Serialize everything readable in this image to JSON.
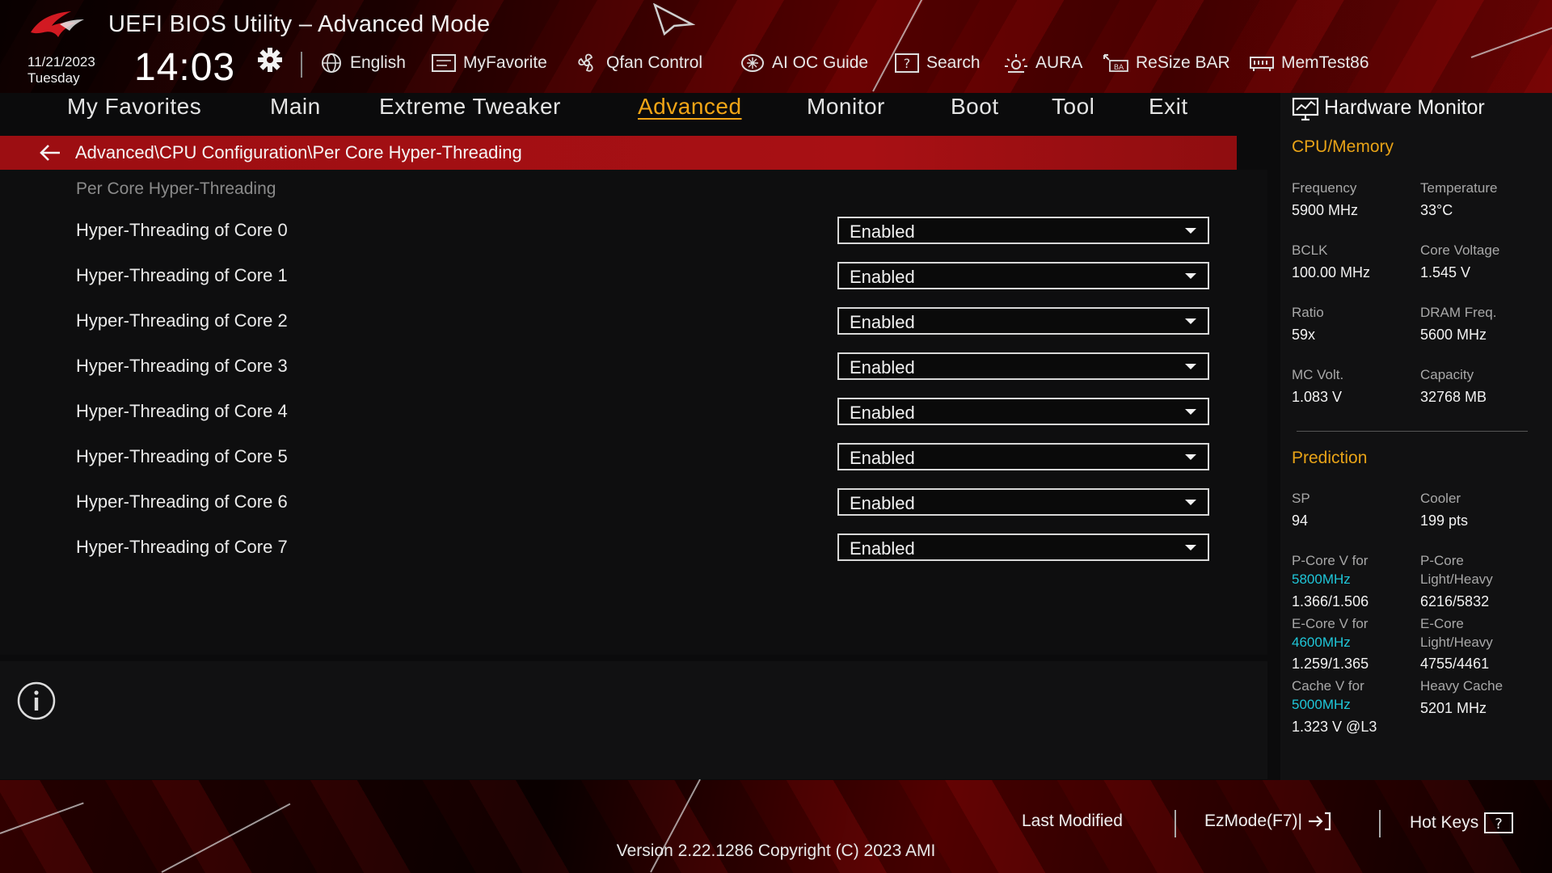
{
  "header": {
    "title": "UEFI BIOS Utility – Advanced Mode",
    "date": "11/21/2023",
    "day": "Tuesday",
    "time": "14:03"
  },
  "toolbar": {
    "items": [
      {
        "label": "English",
        "icon": "globe-icon"
      },
      {
        "label": "MyFavorite",
        "icon": "favorite-icon"
      },
      {
        "label": "Qfan Control",
        "icon": "fan-icon"
      },
      {
        "label": "AI OC Guide",
        "icon": "ai-chip-icon"
      },
      {
        "label": "Search",
        "icon": "search-help-icon"
      },
      {
        "label": "AURA",
        "icon": "aura-icon"
      },
      {
        "label": "ReSize BAR",
        "icon": "resize-bar-icon"
      },
      {
        "label": "MemTest86",
        "icon": "memory-icon"
      }
    ]
  },
  "tabs": [
    {
      "label": "My Favorites",
      "active": false
    },
    {
      "label": "Main",
      "active": false
    },
    {
      "label": "Extreme Tweaker",
      "active": false
    },
    {
      "label": "Advanced",
      "active": true
    },
    {
      "label": "Monitor",
      "active": false
    },
    {
      "label": "Boot",
      "active": false
    },
    {
      "label": "Tool",
      "active": false
    },
    {
      "label": "Exit",
      "active": false
    }
  ],
  "breadcrumb": "Advanced\\CPU Configuration\\Per Core Hyper-Threading",
  "section_title": "Per Core Hyper-Threading",
  "settings": [
    {
      "label": "Hyper-Threading of Core 0",
      "value": "Enabled"
    },
    {
      "label": "Hyper-Threading of Core 1",
      "value": "Enabled"
    },
    {
      "label": "Hyper-Threading of Core 2",
      "value": "Enabled"
    },
    {
      "label": "Hyper-Threading of Core 3",
      "value": "Enabled"
    },
    {
      "label": "Hyper-Threading of Core 4",
      "value": "Enabled"
    },
    {
      "label": "Hyper-Threading of Core 5",
      "value": "Enabled"
    },
    {
      "label": "Hyper-Threading of Core 6",
      "value": "Enabled"
    },
    {
      "label": "Hyper-Threading of Core 7",
      "value": "Enabled"
    }
  ],
  "hardware_monitor": {
    "title": "Hardware Monitor",
    "cpu_memory": {
      "heading": "CPU/Memory",
      "items": [
        {
          "label": "Frequency",
          "value": "5900 MHz"
        },
        {
          "label": "Temperature",
          "value": "33°C"
        },
        {
          "label": "BCLK",
          "value": "100.00 MHz"
        },
        {
          "label": "Core Voltage",
          "value": "1.545 V"
        },
        {
          "label": "Ratio",
          "value": "59x"
        },
        {
          "label": "DRAM Freq.",
          "value": "5600 MHz"
        },
        {
          "label": "MC Volt.",
          "value": "1.083 V"
        },
        {
          "label": "Capacity",
          "value": "32768 MB"
        }
      ]
    },
    "prediction": {
      "heading": "Prediction",
      "sp_label": "SP",
      "sp_value": "94",
      "cooler_label": "Cooler",
      "cooler_value": "199 pts",
      "pcore_v_label": "P-Core V for",
      "pcore_v_freq": "5800MHz",
      "pcore_v_value": "1.366/1.506",
      "pcore_lh_label1": "P-Core",
      "pcore_lh_label2": "Light/Heavy",
      "pcore_lh_value": "6216/5832",
      "ecore_v_label": "E-Core V for",
      "ecore_v_freq": "4600MHz",
      "ecore_v_value": "1.259/1.365",
      "ecore_lh_label1": "E-Core",
      "ecore_lh_label2": "Light/Heavy",
      "ecore_lh_value": "4755/4461",
      "cache_v_label": "Cache V for",
      "cache_v_freq": "5000MHz",
      "cache_v_value": "1.323 V @L3",
      "heavy_cache_label": "Heavy Cache",
      "heavy_cache_value": "5201 MHz"
    }
  },
  "footer": {
    "last_modified": "Last Modified",
    "ezmode": "EzMode(F7)|",
    "hot_keys": "Hot Keys",
    "version": "Version 2.22.1286 Copyright (C) 2023 AMI"
  },
  "colors": {
    "accent_orange": "#f2a516",
    "breadcrumb_red": "#a81014",
    "highlight_cyan": "#1fc6d8"
  }
}
